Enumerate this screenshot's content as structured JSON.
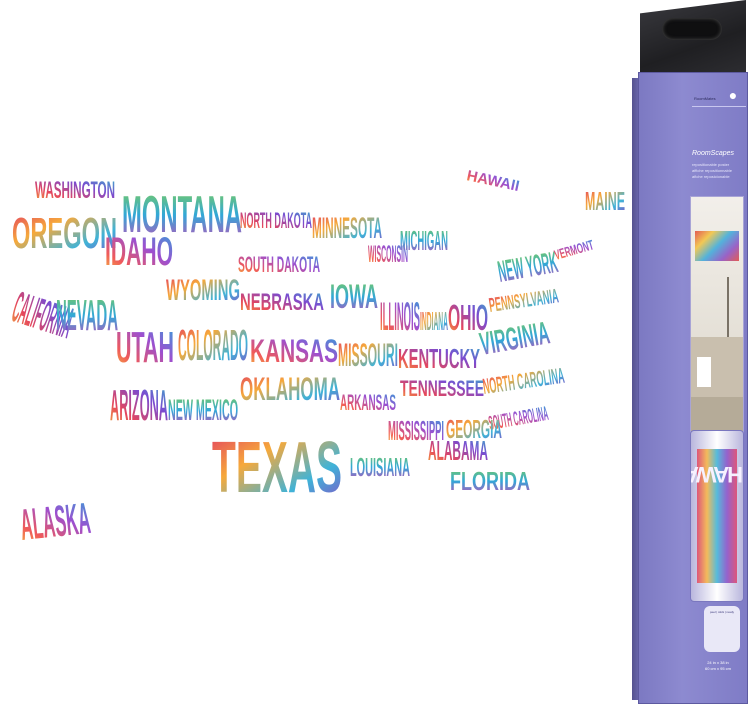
{
  "map_words": {
    "hawaii": "HAWAII",
    "maine": "MAINE",
    "washington": "WASHINGTON",
    "oregon": "OREGON",
    "idaho": "IDAHO",
    "montana": "MONTANA",
    "north_dakota": "NORTH DAKOTA",
    "minnesota": "MINNESOTA",
    "wisconsin": "WISCONSIN",
    "michigan": "MICHIGAN",
    "south_dakota": "SOUTH DAKOTA",
    "wyoming": "WYOMING",
    "california": "CALIFORNIA",
    "nevada": "NEVADA",
    "utah": "UTAH",
    "colorado": "COLORADO",
    "nebraska": "NEBRASKA",
    "iowa": "IOWA",
    "illinois": "ILLINOIS",
    "indiana": "INDIANA",
    "ohio": "OHIO",
    "new_york": "NEW YORK",
    "vermont": "VERMONT",
    "pennsylvania": "PENNSYLVANIA",
    "arizona": "ARIZONA",
    "new_mexico": "NEW MEXICO",
    "kansas": "KANSAS",
    "missouri": "MISSOURI",
    "kentucky": "KENTUCKY",
    "virginia": "VIRGINIA",
    "oklahoma": "OKLAHOMA",
    "arkansas": "ARKANSAS",
    "tennessee": "TENNESSEE",
    "north_carolina": "NORTH CAROLINA",
    "south_carolina": "SOUTH CAROLINA",
    "texas": "TEXAS",
    "louisiana": "LOUISIANA",
    "mississippi": "MISSISSIPPI",
    "alabama": "ALABAMA",
    "georgia": "GEORGIA",
    "florida": "FLORIDA",
    "alaska": "ALASKA"
  },
  "package": {
    "brand": "RoomMates",
    "product_name": "RoomScapes",
    "subtitle_1": "repositionable poster",
    "subtitle_2": "affiche repositionnable",
    "subtitle_3": "afiche reposicionable",
    "size_1": "24 in x 38 in",
    "size_2": "60 cm x 95 cm",
    "peel_line": "peel | stick | ready"
  },
  "colors": {
    "box_purple": "#8683cb",
    "box_top": "#2a2a2e",
    "accent_red": "#e0433c",
    "accent_yellow": "#f3c23b",
    "accent_blue": "#38a9d9",
    "accent_purple": "#8a4bc3"
  }
}
